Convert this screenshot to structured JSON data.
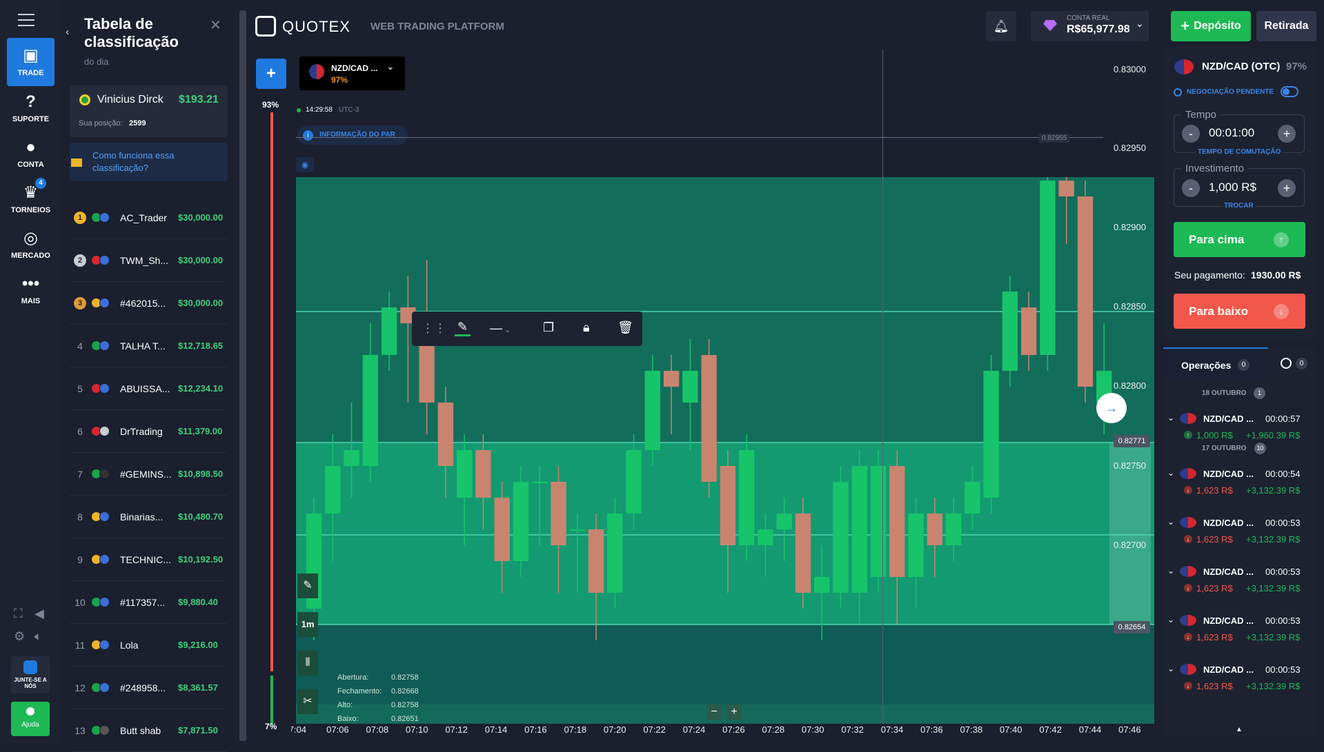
{
  "nav": {
    "items": [
      {
        "label": "TRADE",
        "icon": "chart-icon"
      },
      {
        "label": "SUPORTE",
        "icon": "help-icon"
      },
      {
        "label": "CONTA",
        "icon": "user-icon"
      },
      {
        "label": "TORNEIOS",
        "icon": "trophy-icon",
        "badge": "4"
      },
      {
        "label": "MERCADO",
        "icon": "market-icon"
      },
      {
        "label": "MAIS",
        "icon": "more-icon"
      }
    ],
    "join_label": "JUNTE-SE A NÓS",
    "help_label": "Ajuda"
  },
  "leaderboard": {
    "title": "Tabela de classificação",
    "subtitle": "do dia",
    "user_name": "Vinicius Dirck",
    "user_amount": "$193.21",
    "position_label": "Sua posição:",
    "position_value": "2599",
    "how_it_works": "Como funciona essa classificação?",
    "rows": [
      {
        "rank": "1",
        "name": "AC_Trader",
        "amount": "$30,000.00"
      },
      {
        "rank": "2",
        "name": "TWM_Sh...",
        "amount": "$30,000.00"
      },
      {
        "rank": "3",
        "name": "#462015...",
        "amount": "$30,000.00"
      },
      {
        "rank": "4",
        "name": "TALHA T...",
        "amount": "$12,718.65"
      },
      {
        "rank": "5",
        "name": "ABUISSA...",
        "amount": "$12,234.10"
      },
      {
        "rank": "6",
        "name": "DrTrading",
        "amount": "$11,379.00"
      },
      {
        "rank": "7",
        "name": "#GEMINS...",
        "amount": "$10,898.50"
      },
      {
        "rank": "8",
        "name": "Binarias...",
        "amount": "$10,480.70"
      },
      {
        "rank": "9",
        "name": "TECHNIC...",
        "amount": "$10,192.50"
      },
      {
        "rank": "10",
        "name": "#117357...",
        "amount": "$9,880.40"
      },
      {
        "rank": "11",
        "name": "Lola",
        "amount": "$9,216.00"
      },
      {
        "rank": "12",
        "name": "#248958...",
        "amount": "$8,361.57"
      },
      {
        "rank": "13",
        "name": "Butt shab",
        "amount": "$7,871.50"
      }
    ]
  },
  "header": {
    "brand": "QUOTEX",
    "tagline": "WEB TRADING PLATFORM",
    "account_label": "CONTA REAL",
    "balance": "R$65,977.98",
    "deposit_label": "Depósito",
    "withdraw_label": "Retirada"
  },
  "asset_tab": {
    "name": "NZD/CAD ...",
    "payout": "97%"
  },
  "chart_info": {
    "time": "14:29:58",
    "tz": "UTC-3",
    "pair_info": "INFORMAÇÃO DO PAR",
    "pct_up": "93%",
    "pct_down": "7%",
    "timeframe": "1m",
    "ohlc": [
      {
        "label": "Abertura:",
        "value": "0.82758"
      },
      {
        "label": "Fechamento:",
        "value": "0.82668"
      },
      {
        "label": "Alto:",
        "value": "0.82758"
      },
      {
        "label": "Baixo:",
        "value": "0.82651"
      }
    ],
    "line_price": "0.82955",
    "marker_high": "0.82771",
    "marker_low": "0.82654"
  },
  "chart_data": {
    "type": "candlestick",
    "y_ticks": [
      "0.83000",
      "0.82950",
      "0.82900",
      "0.82850",
      "0.82800",
      "0.82750",
      "0.82700"
    ],
    "x_ticks": [
      "07:04",
      "07:06",
      "07:08",
      "07:10",
      "07:12",
      "07:14",
      "07:16",
      "07:18",
      "07:20",
      "07:22",
      "07:24",
      "07:26",
      "07:28",
      "07:30",
      "07:32",
      "07:34",
      "07:36",
      "07:38",
      "07:40",
      "07:42",
      "07:44",
      "07:46"
    ],
    "ylim": [
      0.8264,
      0.8302
    ],
    "candles": [
      {
        "o": 0.8266,
        "c": 0.8272,
        "h": 0.8273,
        "l": 0.8264
      },
      {
        "o": 0.8272,
        "c": 0.8275,
        "h": 0.8277,
        "l": 0.8269
      },
      {
        "o": 0.8275,
        "c": 0.8276,
        "h": 0.8279,
        "l": 0.8273
      },
      {
        "o": 0.8275,
        "c": 0.8282,
        "h": 0.8284,
        "l": 0.8274
      },
      {
        "o": 0.8282,
        "c": 0.8285,
        "h": 0.8286,
        "l": 0.8281
      },
      {
        "o": 0.8285,
        "c": 0.8284,
        "h": 0.8287,
        "l": 0.8279
      },
      {
        "o": 0.8283,
        "c": 0.8279,
        "h": 0.8288,
        "l": 0.8277
      },
      {
        "o": 0.8279,
        "c": 0.8275,
        "h": 0.828,
        "l": 0.8273
      },
      {
        "o": 0.8273,
        "c": 0.8276,
        "h": 0.8277,
        "l": 0.827
      },
      {
        "o": 0.8276,
        "c": 0.8273,
        "h": 0.8277,
        "l": 0.8271
      },
      {
        "o": 0.8273,
        "c": 0.8269,
        "h": 0.8274,
        "l": 0.8267
      },
      {
        "o": 0.8269,
        "c": 0.8274,
        "h": 0.8275,
        "l": 0.8268
      },
      {
        "o": 0.8274,
        "c": 0.8274,
        "h": 0.8275,
        "l": 0.827
      },
      {
        "o": 0.8274,
        "c": 0.827,
        "h": 0.8275,
        "l": 0.8267
      },
      {
        "o": 0.8271,
        "c": 0.8271,
        "h": 0.8272,
        "l": 0.8267
      },
      {
        "o": 0.8271,
        "c": 0.8267,
        "h": 0.8272,
        "l": 0.8264
      },
      {
        "o": 0.8267,
        "c": 0.8272,
        "h": 0.8273,
        "l": 0.8266
      },
      {
        "o": 0.8272,
        "c": 0.8276,
        "h": 0.8277,
        "l": 0.8271
      },
      {
        "o": 0.8276,
        "c": 0.8281,
        "h": 0.8282,
        "l": 0.8275
      },
      {
        "o": 0.8281,
        "c": 0.828,
        "h": 0.8282,
        "l": 0.8277
      },
      {
        "o": 0.8279,
        "c": 0.8281,
        "h": 0.8283,
        "l": 0.8276
      },
      {
        "o": 0.8282,
        "c": 0.8274,
        "h": 0.8283,
        "l": 0.8273
      },
      {
        "o": 0.8275,
        "c": 0.827,
        "h": 0.8276,
        "l": 0.8267
      },
      {
        "o": 0.827,
        "c": 0.8276,
        "h": 0.8277,
        "l": 0.8269
      },
      {
        "o": 0.827,
        "c": 0.8271,
        "h": 0.8272,
        "l": 0.8268
      },
      {
        "o": 0.8271,
        "c": 0.8272,
        "h": 0.8273,
        "l": 0.8269
      },
      {
        "o": 0.8272,
        "c": 0.8267,
        "h": 0.8273,
        "l": 0.8266
      },
      {
        "o": 0.8267,
        "c": 0.8268,
        "h": 0.827,
        "l": 0.8264
      },
      {
        "o": 0.8267,
        "c": 0.8274,
        "h": 0.8275,
        "l": 0.8266
      },
      {
        "o": 0.8267,
        "c": 0.8275,
        "h": 0.8276,
        "l": 0.8265
      },
      {
        "o": 0.8268,
        "c": 0.8275,
        "h": 0.8276,
        "l": 0.8267
      },
      {
        "o": 0.8275,
        "c": 0.8268,
        "h": 0.8276,
        "l": 0.8265
      },
      {
        "o": 0.8268,
        "c": 0.8272,
        "h": 0.8273,
        "l": 0.8266
      },
      {
        "o": 0.8272,
        "c": 0.827,
        "h": 0.8273,
        "l": 0.8268
      },
      {
        "o": 0.827,
        "c": 0.8272,
        "h": 0.8273,
        "l": 0.8269
      },
      {
        "o": 0.8272,
        "c": 0.8274,
        "h": 0.8275,
        "l": 0.8271
      },
      {
        "o": 0.8273,
        "c": 0.8281,
        "h": 0.8282,
        "l": 0.8272
      },
      {
        "o": 0.8281,
        "c": 0.8286,
        "h": 0.8287,
        "l": 0.828
      },
      {
        "o": 0.8285,
        "c": 0.8282,
        "h": 0.8286,
        "l": 0.8281
      },
      {
        "o": 0.8282,
        "c": 0.8293,
        "h": 0.8295,
        "l": 0.8281
      },
      {
        "o": 0.8293,
        "c": 0.8292,
        "h": 0.8296,
        "l": 0.8289
      },
      {
        "o": 0.8292,
        "c": 0.828,
        "h": 0.8293,
        "l": 0.8279
      },
      {
        "o": 0.8279,
        "c": 0.8281,
        "h": 0.8284,
        "l": 0.8277
      }
    ]
  },
  "trade_panel": {
    "asset": "NZD/CAD (OTC)",
    "payout": "97%",
    "pending_label": "NEGOCIAÇÃO PENDENTE",
    "time_label": "Tempo",
    "time_value": "00:01:00",
    "time_sub": "TEMPO DE COMUTAÇÃO",
    "invest_label": "Investimento",
    "invest_value": "1,000 R$",
    "invest_sub": "TROCAR",
    "up_label": "Para cima",
    "payout_label": "Seu pagamento:",
    "payout_value": "1930.00 R$",
    "down_label": "Para baixo"
  },
  "operations": {
    "tab_label": "Operações",
    "tab_count": "0",
    "history_count": "0",
    "groups": [
      {
        "date": "18 OUTUBRO",
        "count": "1",
        "items": [
          {
            "asset": "NZD/CAD ...",
            "time": "00:00:57",
            "amount": "1,000 R$",
            "profit": "+1,960.39 R$",
            "dir": "up"
          }
        ]
      },
      {
        "date": "17 OUTUBRO",
        "count": "10",
        "items": [
          {
            "asset": "NZD/CAD ...",
            "time": "00:00:54",
            "amount": "1,623 R$",
            "profit": "+3,132.39 R$",
            "dir": "down"
          },
          {
            "asset": "NZD/CAD ...",
            "time": "00:00:53",
            "amount": "1,623 R$",
            "profit": "+3,132.39 R$",
            "dir": "down"
          },
          {
            "asset": "NZD/CAD ...",
            "time": "00:00:53",
            "amount": "1,623 R$",
            "profit": "+3,132.39 R$",
            "dir": "down"
          },
          {
            "asset": "NZD/CAD ...",
            "time": "00:00:53",
            "amount": "1,623 R$",
            "profit": "+3,132.39 R$",
            "dir": "down"
          },
          {
            "asset": "NZD/CAD ...",
            "time": "00:00:53",
            "amount": "1,623 R$",
            "profit": "+3,132.39 R$",
            "dir": "down"
          }
        ]
      }
    ]
  },
  "colors": {
    "accent": "#1f7ae0",
    "up": "#1db954",
    "down": "#f1574a",
    "panel": "#1d2231"
  }
}
